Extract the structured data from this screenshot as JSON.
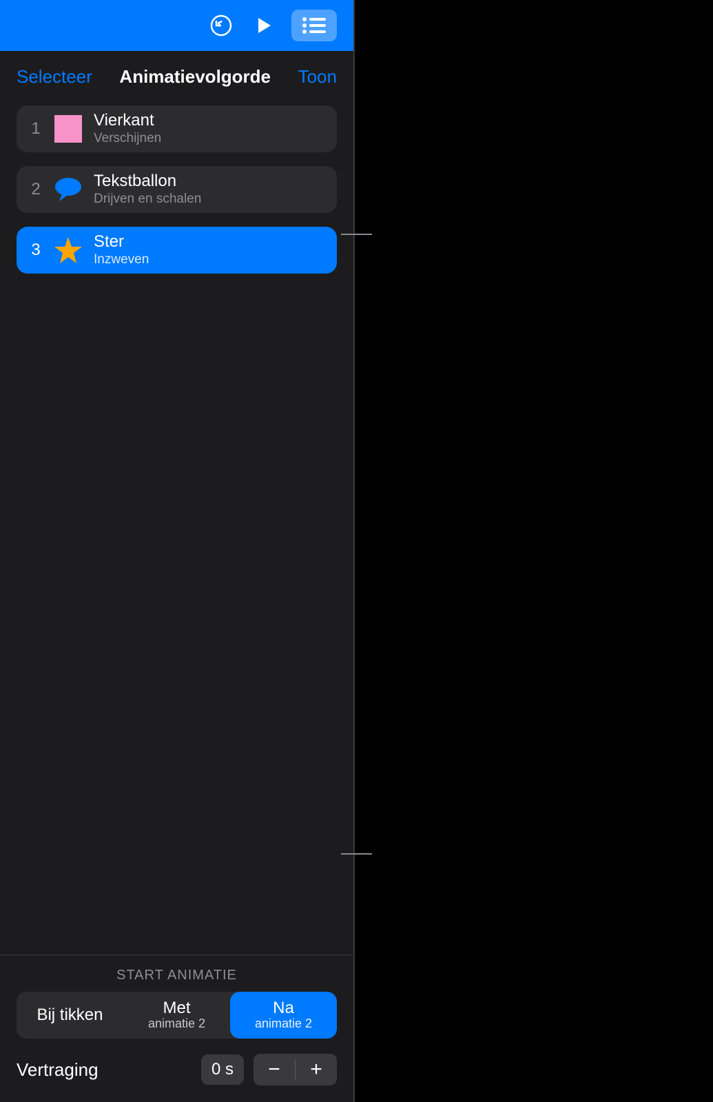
{
  "header": {
    "select_label": "Selecteer",
    "title": "Animatievolgorde",
    "show_label": "Toon"
  },
  "items": [
    {
      "number": "1",
      "title": "Vierkant",
      "subtitle": "Verschijnen",
      "icon": "square",
      "selected": false
    },
    {
      "number": "2",
      "title": "Tekstballon",
      "subtitle": "Drijven en schalen",
      "icon": "speech",
      "selected": false
    },
    {
      "number": "3",
      "title": "Ster",
      "subtitle": "Inzweven",
      "icon": "star",
      "selected": true
    }
  ],
  "bottom": {
    "section_label": "START ANIMATIE",
    "segments": [
      {
        "title": "Bij tikken",
        "subtitle": "",
        "active": false
      },
      {
        "title": "Met",
        "subtitle": "animatie 2",
        "active": false
      },
      {
        "title": "Na",
        "subtitle": "animatie 2",
        "active": true
      }
    ],
    "delay_label": "Vertraging",
    "delay_value": "0 s"
  },
  "icons": {
    "undo": "undo-icon",
    "play": "play-icon",
    "list": "list-icon",
    "minus": "−",
    "plus": "+"
  },
  "colors": {
    "accent": "#007aff",
    "pink": "#f893c9",
    "star": "#ffa500"
  }
}
